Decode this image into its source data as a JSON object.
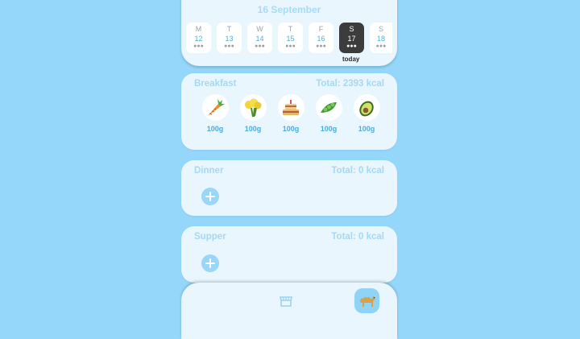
{
  "calendar": {
    "month_title": "16 September",
    "days": [
      {
        "letter": "M",
        "num": "12",
        "dots": "●●●"
      },
      {
        "letter": "T",
        "num": "13",
        "dots": "●●●"
      },
      {
        "letter": "W",
        "num": "14",
        "dots": "●●●"
      },
      {
        "letter": "T",
        "num": "15",
        "dots": "●●●"
      },
      {
        "letter": "F",
        "num": "16",
        "dots": "●●●"
      },
      {
        "letter": "S",
        "num": "17",
        "dots": "●●●"
      },
      {
        "letter": "S",
        "num": "18",
        "dots": "●●●"
      }
    ],
    "today_label": "today"
  },
  "meals": {
    "breakfast": {
      "title": "Breakfast",
      "total": "Total: 2393 kcal",
      "foods": [
        {
          "icon": "carrot-icon",
          "qty": "100g"
        },
        {
          "icon": "broccoli-icon",
          "qty": "100g"
        },
        {
          "icon": "cake-icon",
          "qty": "100g"
        },
        {
          "icon": "peas-icon",
          "qty": "100g"
        },
        {
          "icon": "avocado-icon",
          "qty": "100g"
        }
      ]
    },
    "dinner": {
      "title": "Dinner",
      "total": "Total: 0 kcal"
    },
    "supper": {
      "title": "Supper",
      "total": "Total: 0 kcal"
    }
  },
  "nav": {
    "items": [
      {
        "icon": "store-icon",
        "active": false
      },
      {
        "icon": "camel-icon",
        "active": true
      }
    ]
  },
  "colors": {
    "background": "#95d7fb",
    "card": "#e9f6fe",
    "accent": "#48ade0",
    "selected_day": "#3c3c3c"
  }
}
